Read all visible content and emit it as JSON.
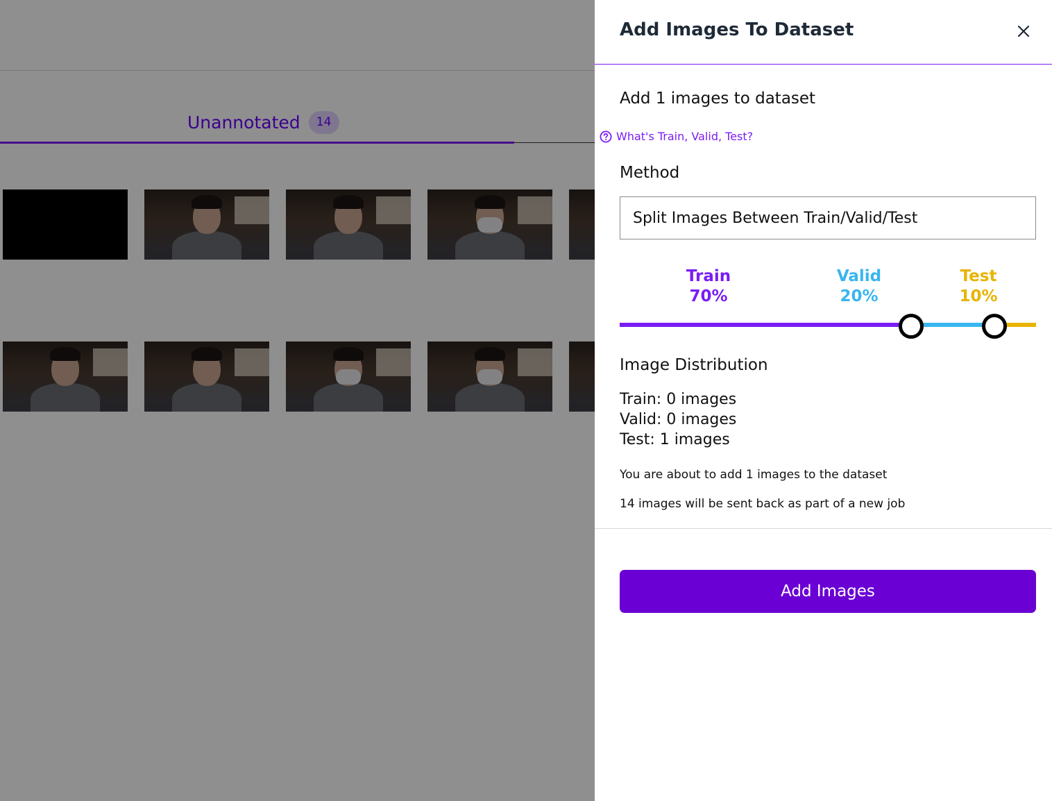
{
  "background": {
    "tab": {
      "label": "Unannotated",
      "count": "14"
    },
    "thumbnails": [
      {
        "row": 1,
        "kind": "black"
      },
      {
        "row": 1,
        "kind": "face"
      },
      {
        "row": 1,
        "kind": "face"
      },
      {
        "row": 1,
        "kind": "face-mask"
      },
      {
        "row": 1,
        "kind": "face"
      },
      {
        "row": 2,
        "kind": "face"
      },
      {
        "row": 2,
        "kind": "face"
      },
      {
        "row": 2,
        "kind": "face-mask"
      },
      {
        "row": 2,
        "kind": "face-mask"
      },
      {
        "row": 2,
        "kind": "face"
      }
    ]
  },
  "drawer": {
    "title": "Add Images To Dataset",
    "close_icon": "close-icon",
    "subheading": "Add 1 images to dataset",
    "help_link": "What's Train, Valid, Test?",
    "help_icon": "help-circle-icon",
    "method_label": "Method",
    "method_value": "Split Images Between Train/Valid/Test",
    "split": {
      "train": {
        "label": "Train",
        "percent": "70%",
        "value": 70,
        "color": "#7a1cf5"
      },
      "valid": {
        "label": "Valid",
        "percent": "20%",
        "value": 20,
        "color": "#39b6f0"
      },
      "test": {
        "label": "Test",
        "percent": "10%",
        "value": 10,
        "color": "#e8b400"
      }
    },
    "distribution_heading": "Image Distribution",
    "distribution": {
      "train": "Train: 0 images",
      "valid": "Valid: 0 images",
      "test": "Test: 1 images"
    },
    "note_add": "You are about to add 1 images to the dataset",
    "note_job": "14 images will be sent back as part of a new job",
    "primary_button": "Add Images",
    "accent_color": "#6a00d3"
  }
}
